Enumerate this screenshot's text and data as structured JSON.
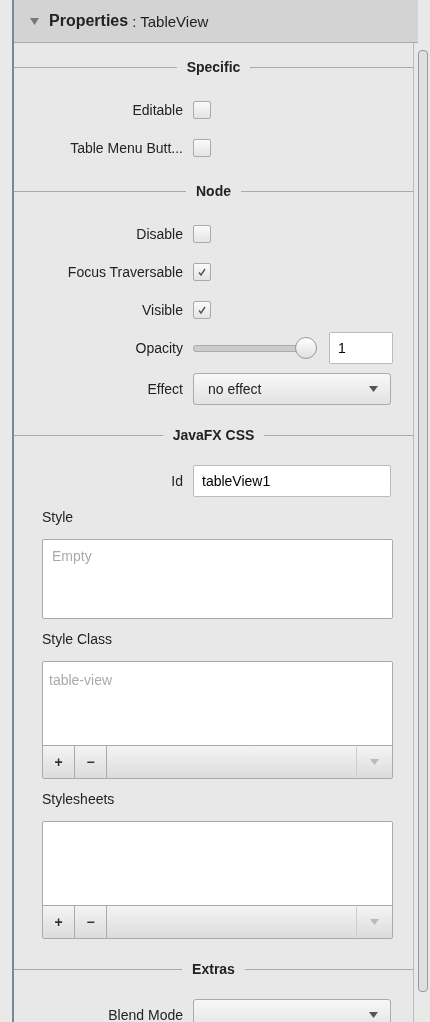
{
  "panel": {
    "title": "Properties",
    "subject": ": TableView"
  },
  "sections": [
    {
      "title": "Specific",
      "rows": [
        {
          "kind": "checkbox",
          "label": "Editable",
          "checked": false
        },
        {
          "kind": "checkbox",
          "label": "Table Menu Butt...",
          "checked": false
        }
      ]
    },
    {
      "title": "Node",
      "rows": [
        {
          "kind": "checkbox",
          "label": "Disable",
          "checked": false
        },
        {
          "kind": "checkbox",
          "label": "Focus Traversable",
          "checked": true
        },
        {
          "kind": "checkbox",
          "label": "Visible",
          "checked": true
        },
        {
          "kind": "slider",
          "label": "Opacity",
          "level": 1,
          "value": "1"
        },
        {
          "kind": "dropdown",
          "label": "Effect",
          "value": "no effect"
        }
      ]
    },
    {
      "title": "JavaFX CSS",
      "rows": [
        {
          "kind": "text",
          "label": "Id",
          "value": "tableView1"
        },
        {
          "kind": "textarea",
          "label": "Style",
          "placeholder": "Empty"
        },
        {
          "kind": "list",
          "label": "Style Class",
          "placeholder": "table-view",
          "add": "+",
          "remove": "−"
        },
        {
          "kind": "list",
          "label": "Stylesheets",
          "add": "+",
          "remove": "−"
        }
      ]
    },
    {
      "title": "Extras",
      "rows": [
        {
          "kind": "dropdown",
          "label": "Blend Mode"
        }
      ]
    }
  ]
}
